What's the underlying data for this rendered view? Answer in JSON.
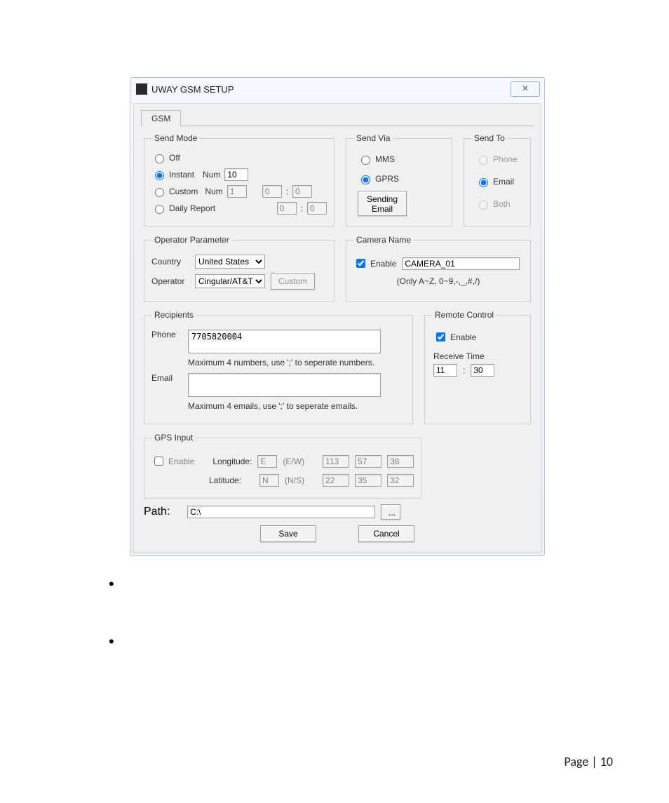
{
  "window": {
    "title": "UWAY GSM SETUP",
    "close_symbol": "✕"
  },
  "tab": {
    "label": "GSM"
  },
  "send_mode": {
    "legend": "Send Mode",
    "options": {
      "off": "Off",
      "instant": "Instant",
      "custom": "Custom",
      "daily": "Daily Report"
    },
    "selected": "instant",
    "num_label": "Num",
    "instant_num": "10",
    "custom_num": "1",
    "custom_h": "0",
    "custom_m": "0",
    "daily_h": "0",
    "daily_m": "0",
    "colon": ":"
  },
  "send_via": {
    "legend": "Send Via",
    "options": {
      "mms": "MMS",
      "gprs": "GPRS"
    },
    "selected": "gprs",
    "sending_email_btn": "Sending Email"
  },
  "send_to": {
    "legend": "Send To",
    "options": {
      "phone": "Phone",
      "email": "Email",
      "both": "Both"
    },
    "selected": "email"
  },
  "operator": {
    "legend": "Operator Parameter",
    "country_label": "Country",
    "country_value": "United States",
    "operator_label": "Operator",
    "operator_value": "Cingular/AT&T",
    "custom_btn": "Custom"
  },
  "camera": {
    "legend": "Camera Name",
    "enable_label": "Enable",
    "enabled": true,
    "name": "CAMERA_01",
    "hint": "(Only A~Z, 0~9,-,_,#,/)"
  },
  "recipients": {
    "legend": "Recipients",
    "phone_label": "Phone",
    "phone_value": "7705820004",
    "phone_hint": "Maximum 4 numbers, use ';' to  seperate  numbers.",
    "email_label": "Email",
    "email_value": "",
    "email_hint": "Maximum 4 emails, use ';' to seperate emails."
  },
  "remote": {
    "legend": "Remote Control",
    "enable_label": "Enable",
    "enabled": true,
    "receive_label": "Receive Time",
    "hour": "11",
    "minute": "30",
    "colon": ":"
  },
  "gps": {
    "legend": "GPS Input",
    "enable_label": "Enable",
    "enabled": false,
    "longitude_label": "Longitude:",
    "lon_dir": "E",
    "lon_dir_hint": "(E/W)",
    "lon_a": "113",
    "lon_b": "57",
    "lon_c": "38",
    "latitude_label": "Latitude:",
    "lat_dir": "N",
    "lat_dir_hint": "(N/S)",
    "lat_a": "22",
    "lat_b": "35",
    "lat_c": "32"
  },
  "path": {
    "label": "Path:",
    "value": "C:\\",
    "browse": "..."
  },
  "buttons": {
    "save": "Save",
    "cancel": "Cancel"
  },
  "footer": {
    "page_label": "Page | ",
    "page_number": "10"
  }
}
